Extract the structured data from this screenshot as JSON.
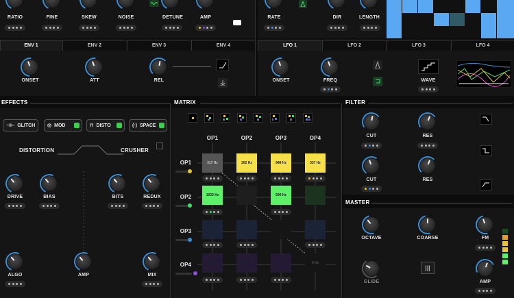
{
  "osc": {
    "knobs": [
      "RATIO",
      "FINE",
      "SKEW",
      "NOISE",
      "DETUNE",
      "AMP"
    ]
  },
  "lfo_top": {
    "knobs": [
      "RATE",
      "DIR",
      "LENGTH"
    ]
  },
  "env": {
    "tabs": [
      "ENV 1",
      "ENV 2",
      "ENV 3",
      "ENV 4"
    ],
    "knobs": [
      "ONSET",
      "ATT",
      "REL"
    ]
  },
  "lfo": {
    "tabs": [
      "LFO 1",
      "LFO 2",
      "LFO 3",
      "LFO 4"
    ],
    "knobs": [
      "ONSET",
      "FREQ"
    ],
    "wave_label": "WAVE"
  },
  "effects": {
    "title": "EFFECTS",
    "buttons": [
      "GLITCH",
      "MOD",
      "DISTO",
      "SPACE"
    ],
    "distortion_title": "DISTORTION",
    "crusher_title": "CRUSHER",
    "knobs": [
      "DRIVE",
      "BIAS",
      "BITS",
      "REDUX",
      "ALGO",
      "AMP",
      "MIX"
    ]
  },
  "matrix": {
    "title": "MATRIX",
    "cols": [
      "OP1",
      "OP2",
      "OP3",
      "OP4"
    ],
    "rows": [
      "OP1",
      "OP2",
      "OP3",
      "OP4"
    ],
    "cells": [
      [
        "317 Hz",
        "262 Hz",
        "848 Hz",
        "337 Hz"
      ],
      [
        "1033 Hz",
        "",
        "590 Hz",
        ""
      ],
      [
        "",
        "",
        "",
        "",
        ""
      ],
      [
        "",
        "",
        "",
        "0 Hz"
      ]
    ]
  },
  "filter": {
    "title": "FILTER",
    "knobs": [
      "CUT",
      "RES",
      "CUT",
      "RES"
    ]
  },
  "master": {
    "title": "MASTER",
    "knobs": [
      "OCTAVE",
      "COARSE",
      "FM",
      "GLIDE",
      "AMP"
    ]
  }
}
